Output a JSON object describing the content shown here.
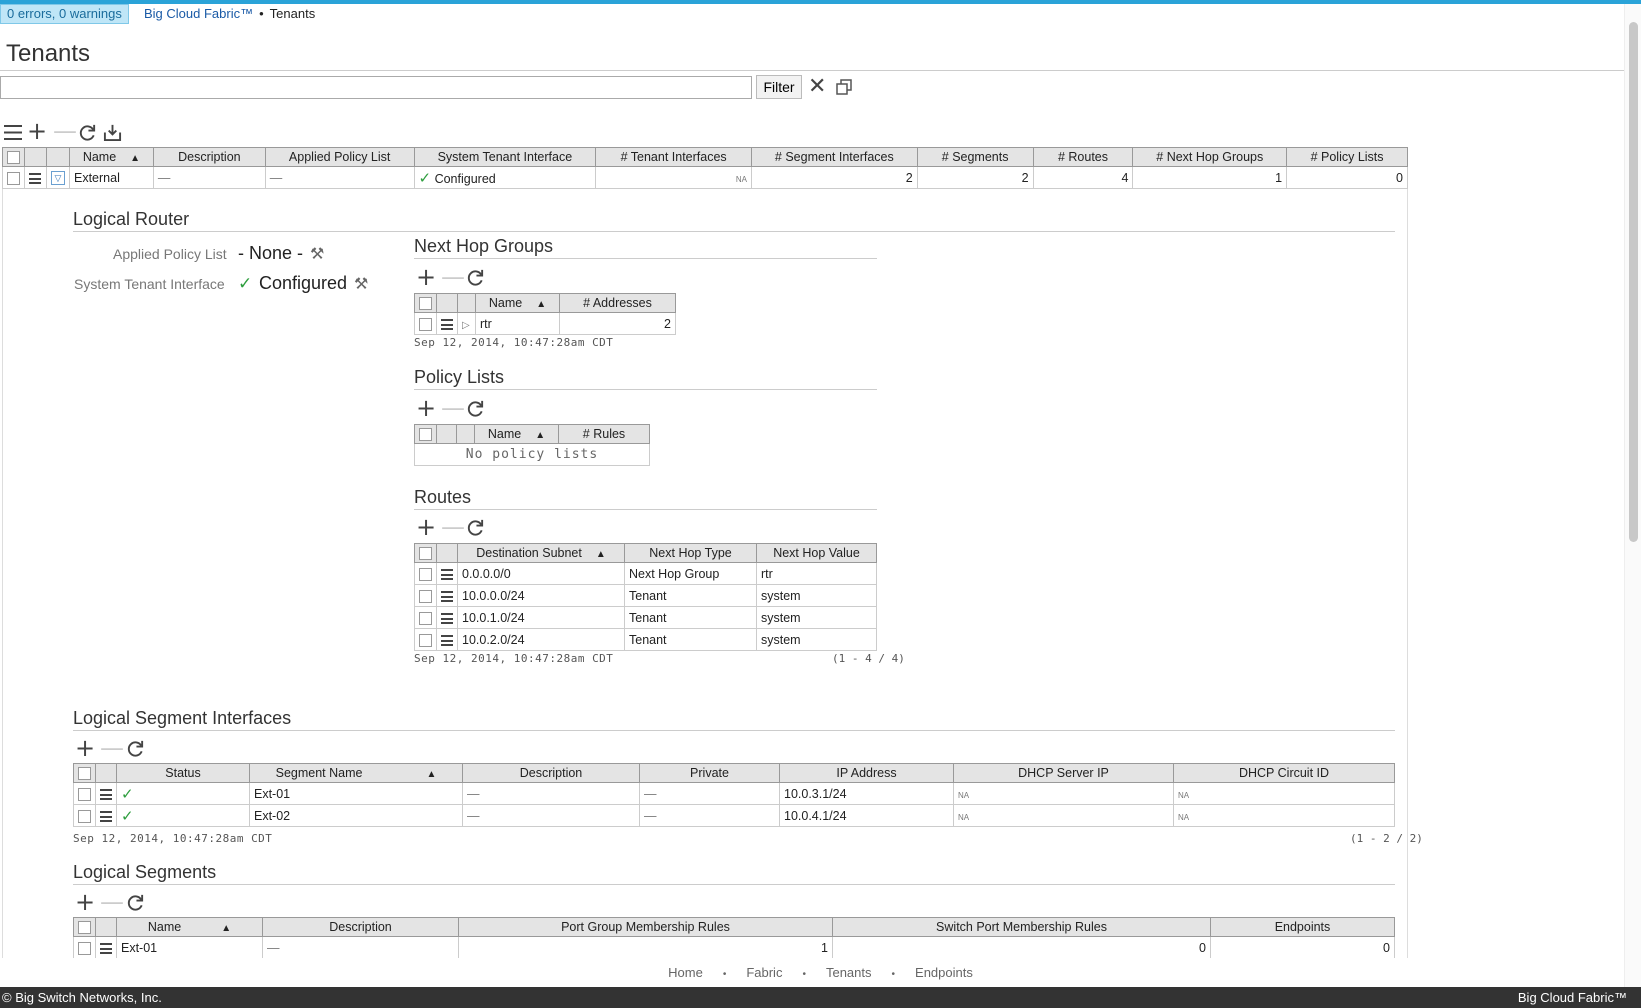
{
  "status_badge": "0 errors, 0 warnings",
  "breadcrumb": {
    "root": "Big Cloud Fabric™",
    "separator": "•",
    "current": "Tenants"
  },
  "page_title": "Tenants",
  "filter": {
    "placeholder": "",
    "button_label": "Filter"
  },
  "icons": {
    "menu": "hamburger-icon",
    "add": "plus-icon",
    "remove": "minus-icon",
    "refresh": "refresh-icon",
    "export": "download-icon",
    "clear": "close-icon",
    "popout": "window-icon",
    "edit": "wrench-icon",
    "check": "check-icon"
  },
  "tenants_table": {
    "headers": {
      "name": "Name",
      "description": "Description",
      "applied_policy_list": "Applied Policy List",
      "system_tenant_interface": "System Tenant Interface",
      "tenant_interfaces": "# Tenant Interfaces",
      "segment_interfaces": "# Segment Interfaces",
      "segments": "# Segments",
      "routes": "# Routes",
      "next_hop_groups": "# Next Hop Groups",
      "policy_lists": "# Policy Lists"
    },
    "rows": [
      {
        "name": "External",
        "description": "—",
        "applied_policy_list": "—",
        "system_tenant_interface": "Configured",
        "tenant_interfaces": "NA",
        "segment_interfaces": "2",
        "segments": "2",
        "routes": "4",
        "next_hop_groups": "1",
        "policy_lists": "0"
      }
    ]
  },
  "logical_router": {
    "title": "Logical Router",
    "applied_policy_list_label": "Applied Policy List",
    "applied_policy_list_value": "- None -",
    "system_tenant_interface_label": "System Tenant Interface",
    "system_tenant_interface_value": "Configured"
  },
  "next_hop_groups": {
    "title": "Next Hop Groups",
    "headers": {
      "name": "Name",
      "addresses": "# Addresses"
    },
    "rows": [
      {
        "name": "rtr",
        "addresses": "2"
      }
    ],
    "timestamp": "Sep 12, 2014, 10:47:28am CDT"
  },
  "policy_lists": {
    "title": "Policy Lists",
    "headers": {
      "name": "Name",
      "rules": "# Rules"
    },
    "empty_text": "No policy lists"
  },
  "routes": {
    "title": "Routes",
    "headers": {
      "destination_subnet": "Destination Subnet",
      "next_hop_type": "Next Hop Type",
      "next_hop_value": "Next Hop Value"
    },
    "rows": [
      {
        "destination_subnet": "0.0.0.0/0",
        "next_hop_type": "Next Hop Group",
        "next_hop_value": "rtr"
      },
      {
        "destination_subnet": "10.0.0.0/24",
        "next_hop_type": "Tenant",
        "next_hop_value": "system"
      },
      {
        "destination_subnet": "10.0.1.0/24",
        "next_hop_type": "Tenant",
        "next_hop_value": "system"
      },
      {
        "destination_subnet": "10.0.2.0/24",
        "next_hop_type": "Tenant",
        "next_hop_value": "system"
      }
    ],
    "timestamp": "Sep 12, 2014, 10:47:28am CDT",
    "count": "(1 - 4 / 4)"
  },
  "segment_interfaces": {
    "title": "Logical Segment Interfaces",
    "headers": {
      "status": "Status",
      "segment_name": "Segment Name",
      "description": "Description",
      "private": "Private",
      "ip_address": "IP Address",
      "dhcp_server_ip": "DHCP Server IP",
      "dhcp_circuit_id": "DHCP Circuit ID"
    },
    "rows": [
      {
        "segment_name": "Ext-01",
        "description": "—",
        "private": "—",
        "ip_address": "10.0.3.1/24",
        "dhcp_server_ip": "NA",
        "dhcp_circuit_id": "NA"
      },
      {
        "segment_name": "Ext-02",
        "description": "—",
        "private": "—",
        "ip_address": "10.0.4.1/24",
        "dhcp_server_ip": "NA",
        "dhcp_circuit_id": "NA"
      }
    ],
    "timestamp": "Sep 12, 2014, 10:47:28am CDT",
    "count": "(1 - 2 / 2)"
  },
  "segments": {
    "title": "Logical Segments",
    "headers": {
      "name": "Name",
      "description": "Description",
      "port_group_rules": "Port Group Membership Rules",
      "switch_port_rules": "Switch Port Membership Rules",
      "endpoints": "Endpoints"
    },
    "rows": [
      {
        "name": "Ext-01",
        "description": "—",
        "port_group_rules": "1",
        "switch_port_rules": "0",
        "endpoints": "0"
      }
    ]
  },
  "footer_nav": {
    "home": "Home",
    "fabric": "Fabric",
    "tenants": "Tenants",
    "endpoints": "Endpoints",
    "dot": "•"
  },
  "footer": {
    "copyright": "© Big Switch Networks, Inc.",
    "brand": "Big Cloud Fabric™"
  }
}
